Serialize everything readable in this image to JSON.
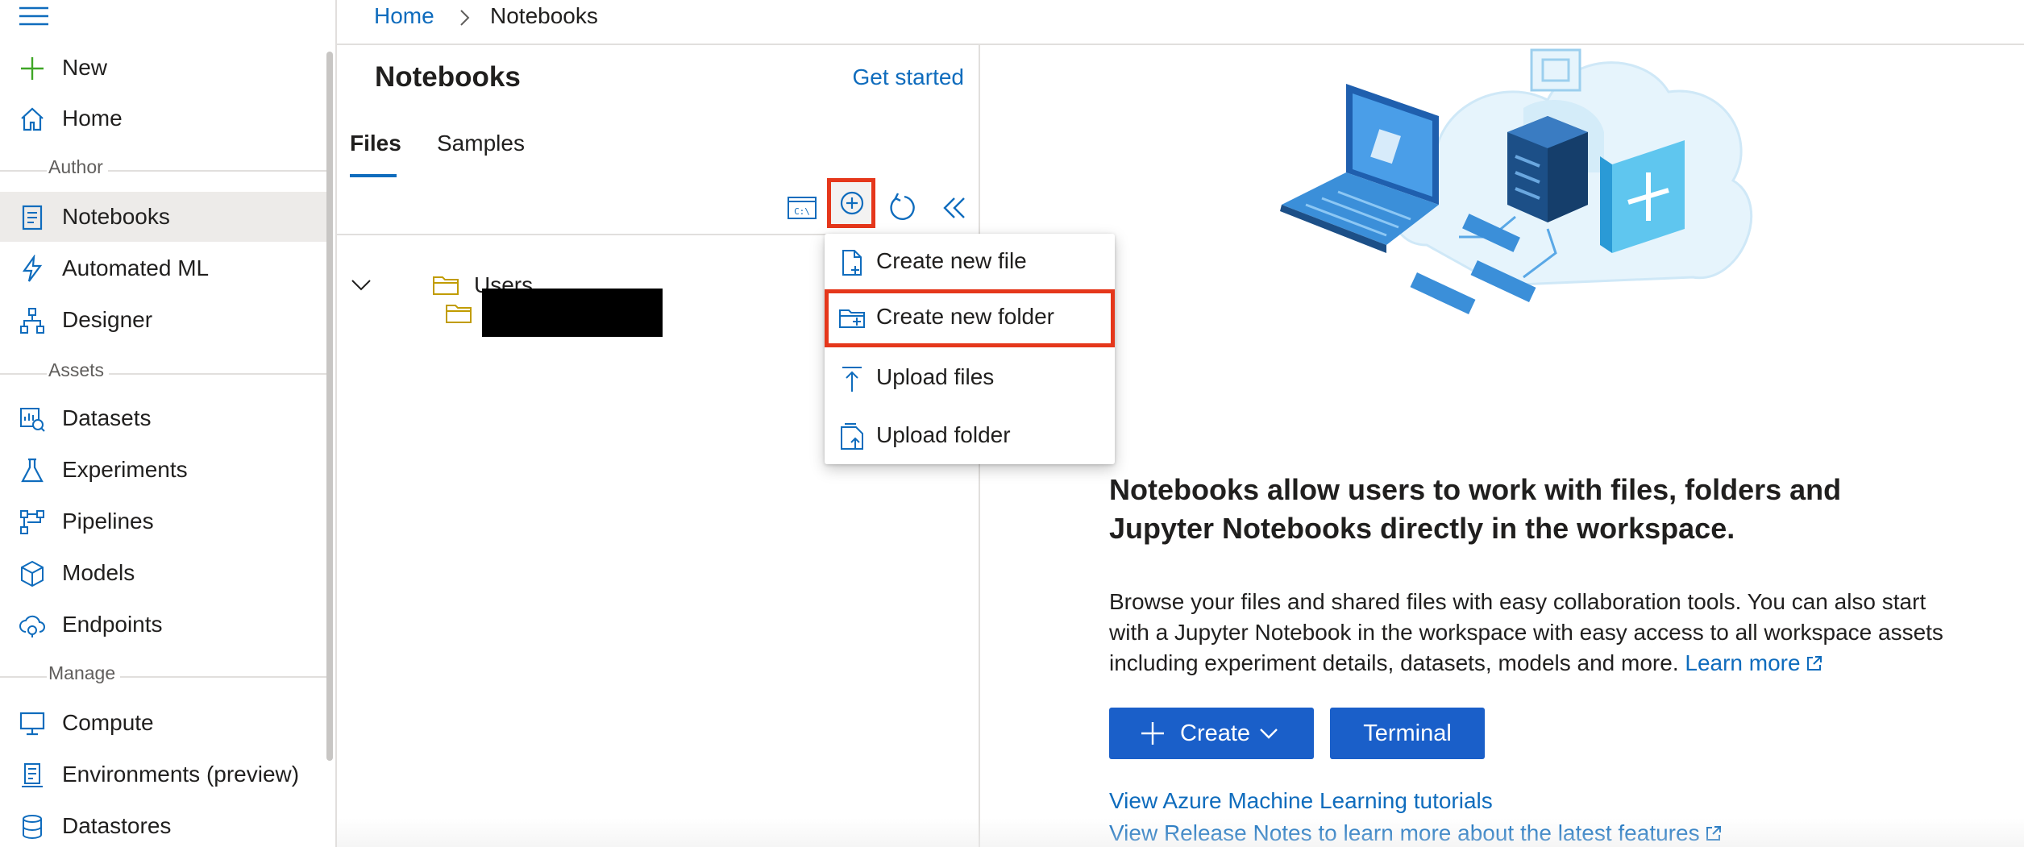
{
  "nav": {
    "items": [
      {
        "label": "New",
        "icon": "plus-icon"
      },
      {
        "label": "Home",
        "icon": "home-icon"
      },
      {
        "label": "Notebooks",
        "icon": "notebook-icon"
      },
      {
        "label": "Automated ML",
        "icon": "automl-icon"
      },
      {
        "label": "Designer",
        "icon": "designer-icon"
      },
      {
        "label": "Datasets",
        "icon": "dataset-icon"
      },
      {
        "label": "Experiments",
        "icon": "flask-icon"
      },
      {
        "label": "Pipelines",
        "icon": "pipeline-icon"
      },
      {
        "label": "Models",
        "icon": "cube-icon"
      },
      {
        "label": "Endpoints",
        "icon": "endpoint-icon"
      },
      {
        "label": "Compute",
        "icon": "monitor-icon"
      },
      {
        "label": "Environments (preview)",
        "icon": "environment-icon"
      },
      {
        "label": "Datastores",
        "icon": "database-icon"
      }
    ],
    "sections": [
      "Author",
      "Assets",
      "Manage"
    ],
    "selected": "Notebooks"
  },
  "breadcrumb": {
    "home": "Home",
    "current": "Notebooks"
  },
  "pane": {
    "title": "Notebooks",
    "get_started": "Get started",
    "tabs": [
      "Files",
      "Samples"
    ],
    "active_tab": "Files",
    "tree": {
      "root": "Users"
    }
  },
  "menu": {
    "items": [
      {
        "label": "Create new file",
        "icon": "new-file-icon"
      },
      {
        "label": "Create new folder",
        "icon": "new-folder-icon"
      },
      {
        "label": "Upload files",
        "icon": "upload-icon"
      },
      {
        "label": "Upload folder",
        "icon": "upload-folder-icon"
      }
    ],
    "highlighted": "Create new folder"
  },
  "main": {
    "headline": "Notebooks allow users to work with files, folders and Jupyter Notebooks directly in the workspace.",
    "description": "Browse your files and shared files with easy collaboration tools. You can also start with a Jupyter Notebook in the workspace with easy access to all workspace assets including experiment details, datasets, models and more.",
    "learn_more": "Learn more",
    "create_button": "Create",
    "terminal_button": "Terminal",
    "link_tutorials": "View Azure Machine Learning tutorials",
    "link_release_notes": "View Release Notes to learn more about the latest features"
  },
  "colors": {
    "accent": "#0f6cbd",
    "button": "#1a5fc9",
    "highlight_box": "#e5371b",
    "folder": "#c19c00"
  }
}
